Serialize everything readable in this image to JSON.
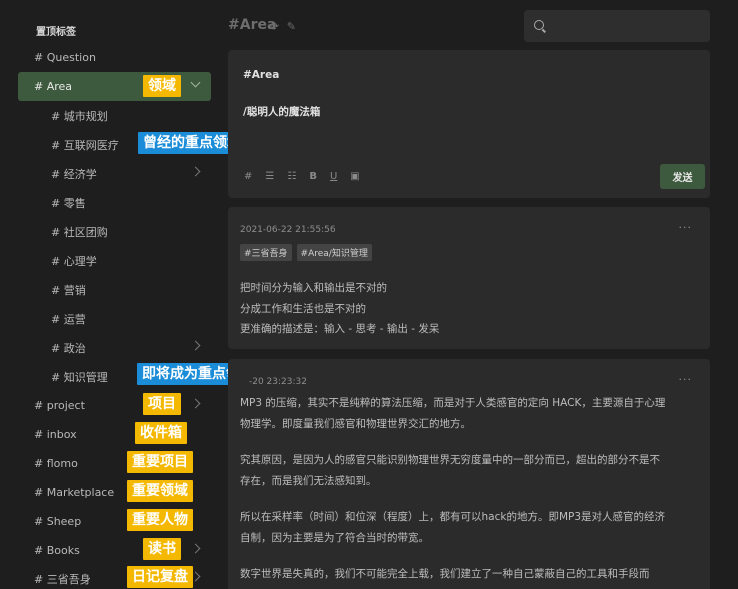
{
  "sidebar": {
    "pinned_title": "置顶标签",
    "items": [
      {
        "label": "# Question"
      },
      {
        "label": "# Area"
      },
      {
        "label": "# 城市规划"
      },
      {
        "label": "# 互联网医疗"
      },
      {
        "label": "# 经济学"
      },
      {
        "label": "# 零售"
      },
      {
        "label": "# 社区团购"
      },
      {
        "label": "# 心理学"
      },
      {
        "label": "# 营销"
      },
      {
        "label": "# 运营"
      },
      {
        "label": "# 政治"
      },
      {
        "label": "# 知识管理"
      },
      {
        "label": "# project"
      },
      {
        "label": "# inbox"
      },
      {
        "label": "# flomo"
      },
      {
        "label": "# Marketplace"
      },
      {
        "label": "# Sheep"
      },
      {
        "label": "# Books"
      },
      {
        "label": "# 三省吾身"
      }
    ]
  },
  "annotations": {
    "area": "领域",
    "internet_medical": "曾经的重点领域",
    "knowledge_mgmt": "即将成为重点领域",
    "project": "项目",
    "inbox": "收件箱",
    "flomo": "重要项目",
    "marketplace": "重要领域",
    "sheep": "重要人物",
    "books": "读书",
    "self_review": "日记复盘"
  },
  "header": {
    "title": "#Area",
    "icons": [
      "refresh-icon",
      "edit-icon"
    ]
  },
  "search": {
    "placeholder": ""
  },
  "editor": {
    "line1": "#Area",
    "line2": "/聪明人的魔法箱",
    "toolbar": {
      "hash": "#",
      "bold": "B",
      "underline": "U"
    },
    "send_label": "发送"
  },
  "memos": [
    {
      "time": "2021-06-22 21:55:56",
      "tags": [
        "#三省吾身",
        "#Area/知识管理"
      ],
      "lines": [
        "把时间分为输入和输出是不对的",
        "分成工作和生活也是不对的",
        "更准确的描述是：输入 - 思考 - 输出 - 发呆"
      ]
    },
    {
      "time": "-20 23:23:32",
      "lines": [
        "MP3 的压缩，其实不是纯粹的算法压缩，而是对于人类感官的定向 HACK，主要源自于心理",
        "物理学。即度量我们感官和物理世界交汇的地方。",
        "究其原因，是因为人的感官只能识别物理世界无穷度量中的一部分而已，超出的部分不是不",
        "存在，而是我们无法感知到。",
        "所以在采样率（时间）和位深（程度）上，都有可以hack的地方。即MP3是对人感官的经济",
        "自制，因为主要是为了符合当时的带宽。",
        "数字世界是失真的，我们不可能完全上载，我们建立了一种自己蒙蔽自己的工具和手段而"
      ]
    }
  ],
  "more_label": "···"
}
